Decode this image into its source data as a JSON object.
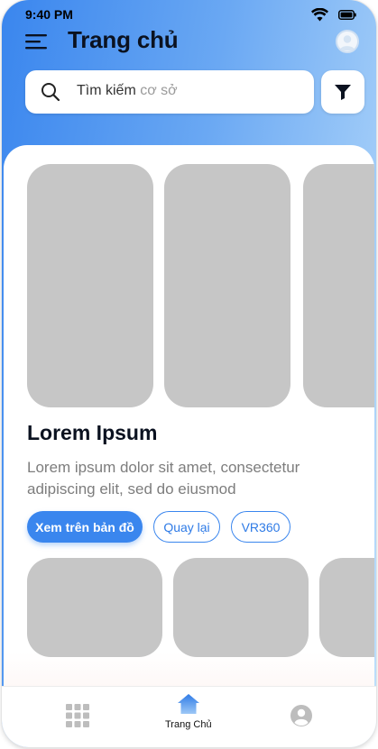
{
  "status_bar": {
    "time": "9:40 PM"
  },
  "header": {
    "title": "Trang chủ"
  },
  "search": {
    "prefix": "Tìm kiếm",
    "placeholder": "cơ sở"
  },
  "category": {
    "title": "Lorem Ipsum",
    "description": "Lorem ipsum dolor sit amet, consectetur adipiscing elit, sed do eiusmod"
  },
  "actions": {
    "map_label": "Xem trên bản đồ",
    "back_label": "Quay lại",
    "vr_label": "VR360"
  },
  "bottom_nav": {
    "home_label": "Trang Chủ"
  },
  "colors": {
    "accent": "#3a86ee",
    "placeholder": "#c6c6c6",
    "title": "#0b1220"
  },
  "icons": [
    "menu-icon",
    "avatar",
    "search-icon",
    "filter-icon",
    "grid-icon",
    "home-icon",
    "profile-icon",
    "wifi-icon",
    "battery-icon"
  ]
}
